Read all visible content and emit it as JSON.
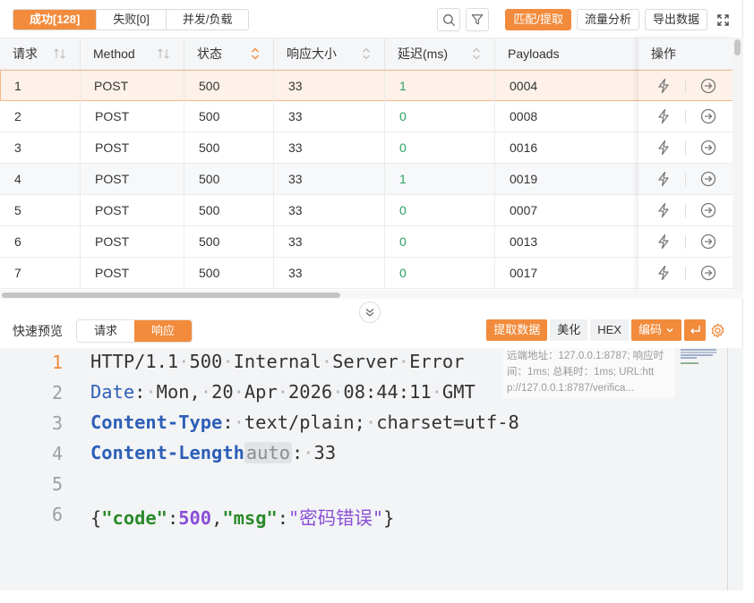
{
  "toolbar": {
    "tabs": [
      {
        "label": "成功[128]",
        "active": true
      },
      {
        "label": "失败[0]",
        "active": false
      },
      {
        "label": "并发/负载",
        "active": false
      }
    ],
    "search_icon": "search-icon",
    "filter_icon": "filter-icon",
    "match_extract": "匹配/提取",
    "traffic_analysis": "流量分析",
    "export_data": "导出数据",
    "fullscreen_icon": "expand-icon"
  },
  "table": {
    "columns": [
      "请求",
      "Method",
      "状态",
      "响应大小",
      "延迟(ms)",
      "Payloads",
      "操作"
    ],
    "rows": [
      {
        "id": "1",
        "method": "POST",
        "status": "500",
        "size": "33",
        "delay": "1",
        "payload": "0004"
      },
      {
        "id": "2",
        "method": "POST",
        "status": "500",
        "size": "33",
        "delay": "0",
        "payload": "0008"
      },
      {
        "id": "3",
        "method": "POST",
        "status": "500",
        "size": "33",
        "delay": "0",
        "payload": "0016"
      },
      {
        "id": "4",
        "method": "POST",
        "status": "500",
        "size": "33",
        "delay": "1",
        "payload": "0019"
      },
      {
        "id": "5",
        "method": "POST",
        "status": "500",
        "size": "33",
        "delay": "0",
        "payload": "0007"
      },
      {
        "id": "6",
        "method": "POST",
        "status": "500",
        "size": "33",
        "delay": "0",
        "payload": "0013"
      },
      {
        "id": "7",
        "method": "POST",
        "status": "500",
        "size": "33",
        "delay": "0",
        "payload": "0017"
      }
    ],
    "selected_row": 0,
    "row_action_icons": [
      "bolt-icon",
      "arrow-right-circle-icon"
    ]
  },
  "preview": {
    "label": "快速预览",
    "tabs": [
      {
        "label": "请求",
        "active": false
      },
      {
        "label": "响应",
        "active": true
      }
    ],
    "extract_data": "提取数据",
    "beautify": "美化",
    "hex": "HEX",
    "encoding": "编码",
    "wrap_icon": "wrap-icon",
    "settings_icon": "gear-icon"
  },
  "editor": {
    "line_numbers": [
      "1",
      "2",
      "3",
      "4",
      "5",
      "6"
    ],
    "line1": [
      "HTTP/1.1",
      "500",
      "Internal",
      "Server",
      "Error"
    ],
    "line2_key": "Date",
    "line2_val": [
      "Mon,",
      "20",
      "Apr",
      "2026",
      "08:44:11",
      "GMT"
    ],
    "line3_key": "Content-Type",
    "line3_val": [
      "text/plain;",
      "charset=utf-8"
    ],
    "line4_key": "Content-Length",
    "line4_auto": "auto",
    "line4_val": "33",
    "line6": {
      "k1": "\"code\"",
      "v1": "500",
      "k2": "\"msg\"",
      "v2": "\"密码错误\""
    },
    "tooltip": [
      "远端地址：127.0.0.1:8787; 响应时",
      "间：1ms; 总耗时：1ms; URL:htt",
      "p://127.0.0.1:8787/verifica..."
    ]
  },
  "colors": {
    "accent": "#f28b3c",
    "green": "#2aa163",
    "key_blue": "#2d5fb8",
    "json_key": "#2a8a2a",
    "json_val": "#8a4fd6"
  }
}
